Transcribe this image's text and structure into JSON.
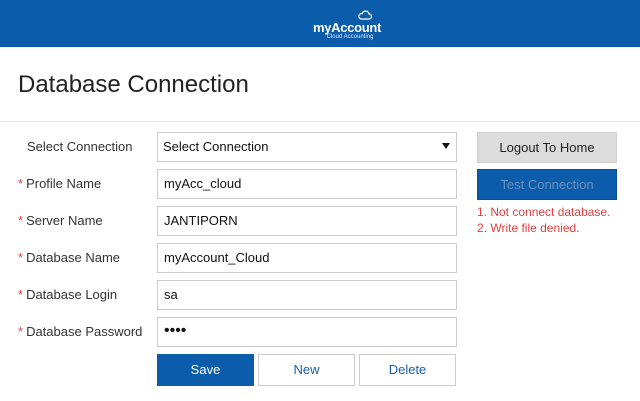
{
  "header": {
    "logo_title_prefix": "my",
    "logo_title_main": "Account",
    "logo_subtitle": "Cloud Accounting",
    "brand_color": "#0b5cab"
  },
  "page": {
    "title": "Database Connection"
  },
  "form": {
    "select_connection": {
      "label": "Select Connection",
      "value": "Select Connection"
    },
    "profile_name": {
      "label": "Profile Name",
      "value": "myAcc_cloud",
      "required": true
    },
    "server_name": {
      "label": "Server Name",
      "value": "JANTIPORN",
      "required": true
    },
    "database_name": {
      "label": "Database Name",
      "value": "myAccount_Cloud",
      "required": true
    },
    "database_login": {
      "label": "Database Login",
      "value": "sa",
      "required": true
    },
    "database_password": {
      "label": "Database Password",
      "value": "••••",
      "required": true
    },
    "required_mark": "*"
  },
  "actions": {
    "save_label": "Save",
    "new_label": "New",
    "delete_label": "Delete",
    "logout_label": "Logout To Home",
    "test_label": "Test Connection"
  },
  "errors": [
    "1. Not connect database.",
    "2. Write file denied."
  ],
  "colors": {
    "primary": "#0b5cab",
    "error": "#e04040",
    "secondary_button": "#dcdcdc"
  }
}
